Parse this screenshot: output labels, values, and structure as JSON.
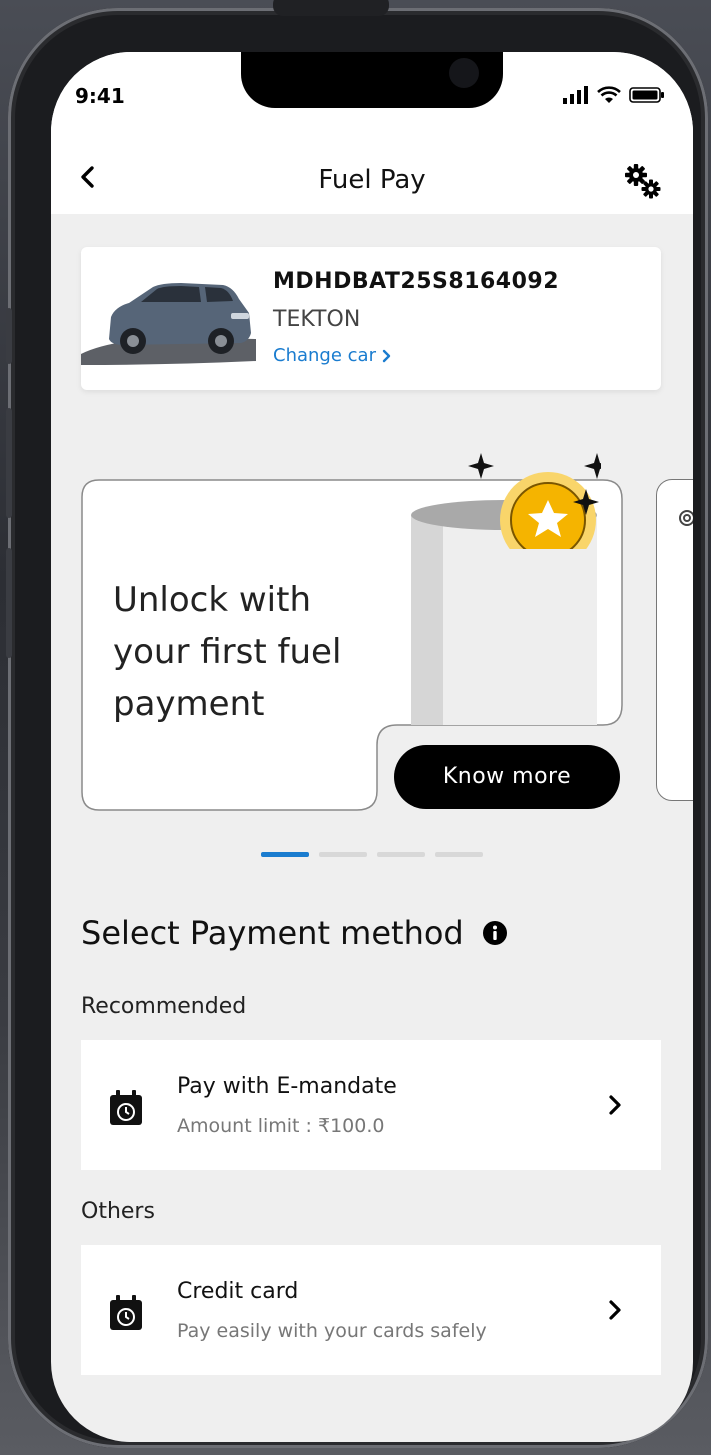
{
  "status_bar": {
    "time": "9:41",
    "icons": [
      "signal-icon",
      "wifi-icon",
      "battery-icon"
    ]
  },
  "header": {
    "title": "Fuel Pay",
    "back_icon": "chevron-left-icon",
    "settings_icon": "gear-icon"
  },
  "car": {
    "vin": "MDHDBAT25S8164092",
    "model": "TEKTON",
    "change_label": "Change car"
  },
  "promo": {
    "text": "Unlock with your first fuel payment",
    "cta": "Know more",
    "indicator_count": 4,
    "active_index": 0
  },
  "payment": {
    "section_title": "Select Payment method",
    "recommended_label": "Recommended",
    "others_label": "Others",
    "methods": [
      {
        "title": "Pay with E-mandate",
        "subtitle": "Amount limit : ₹100.0"
      },
      {
        "title": "Credit card",
        "subtitle": "Pay easily with your cards safely"
      }
    ]
  },
  "colors": {
    "accent": "#1a7ccf",
    "background": "#efefef",
    "button": "#000000",
    "coin": "#f5b400"
  }
}
